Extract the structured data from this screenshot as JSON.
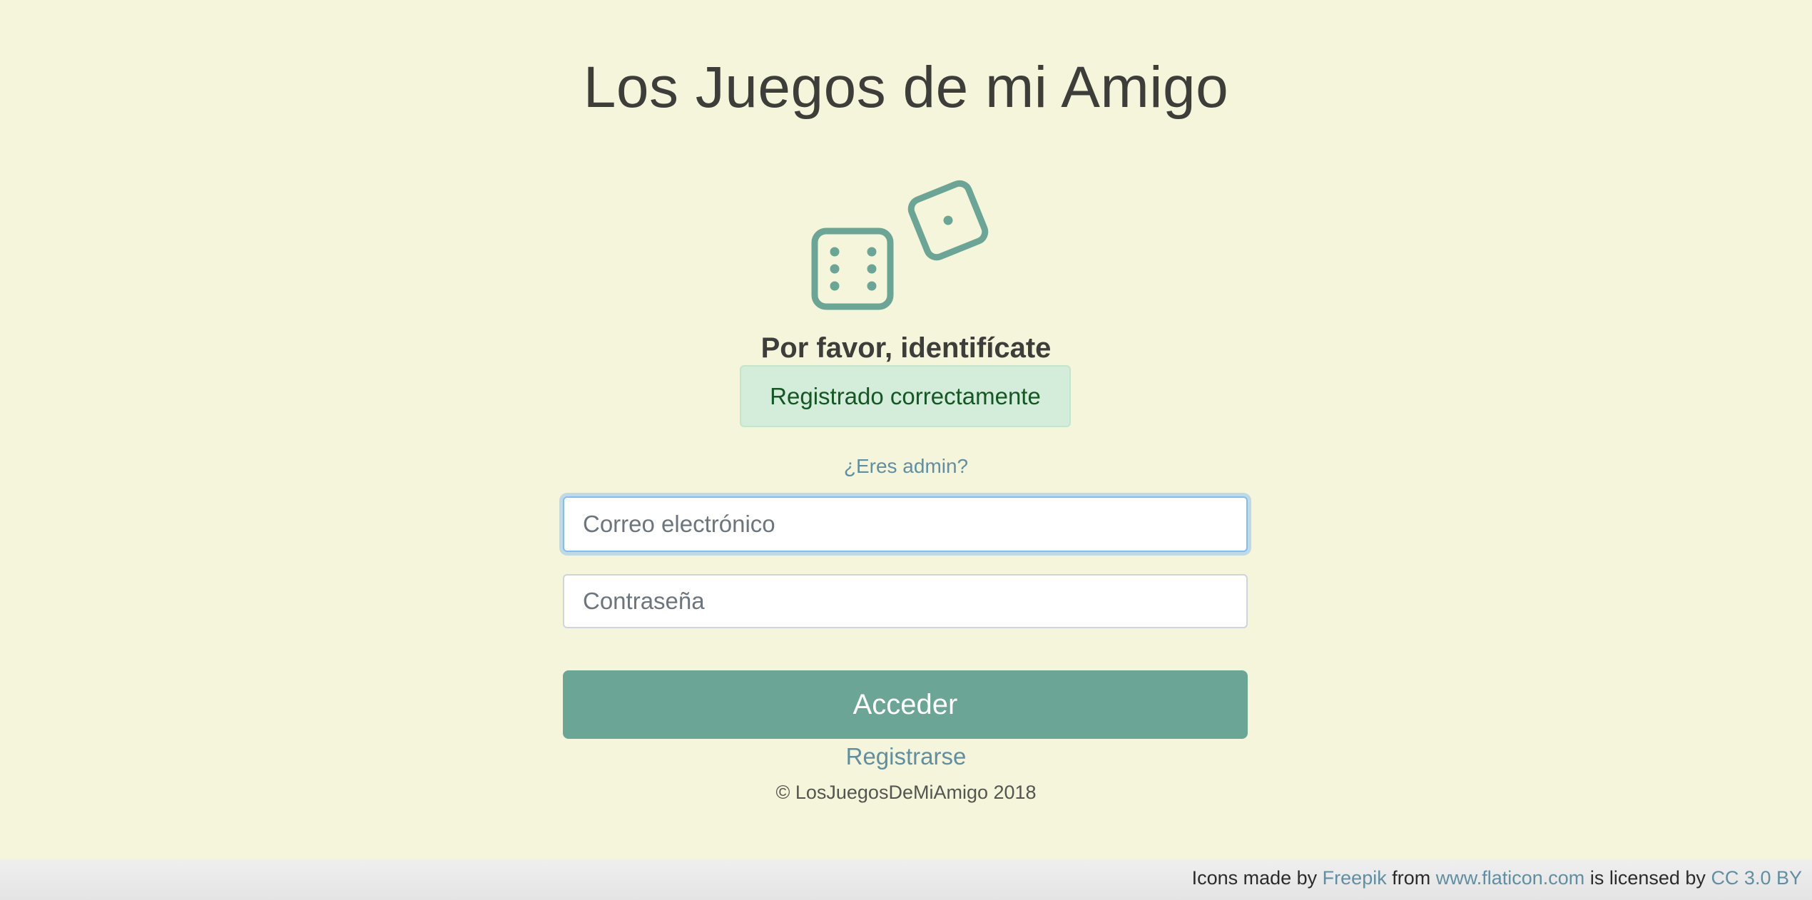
{
  "app": {
    "title": "Los Juegos de mi Amigo"
  },
  "logo": {
    "icon": "dice-icon",
    "color": "#6ba596"
  },
  "login": {
    "heading": "Por favor, identifícate",
    "alert_message": "Registrado correctamente",
    "admin_link": "¿Eres admin?",
    "email_placeholder": "Correo electrónico",
    "email_value": "",
    "password_placeholder": "Contraseña",
    "password_value": "",
    "submit_label": "Acceder",
    "register_link": "Registrarse",
    "copyright": "© LosJuegosDeMiAmigo 2018"
  },
  "footer": {
    "prefix": "Icons made by",
    "author": "Freepik",
    "from": "from",
    "site": "www.flaticon.com",
    "licensed": "is licensed by",
    "license": "CC 3.0 BY"
  },
  "colors": {
    "background": "#f5f5dc",
    "accent": "#6ba596",
    "link": "#5f8fa0",
    "alert_bg": "#d4edda",
    "alert_text": "#155724"
  }
}
